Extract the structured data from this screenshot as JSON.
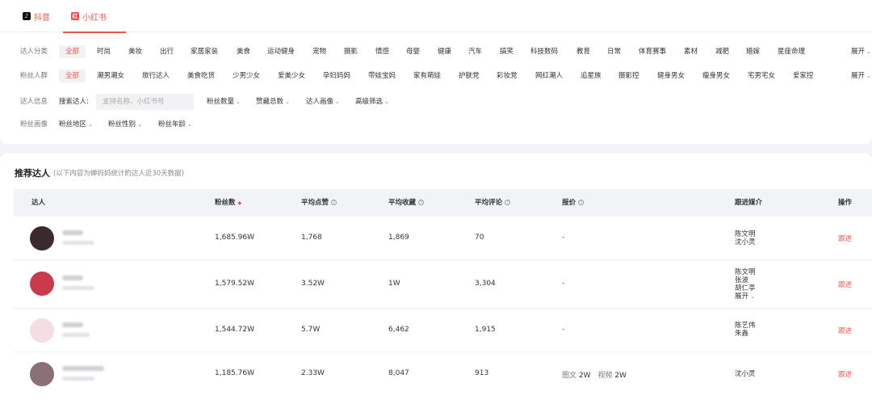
{
  "tabs": [
    {
      "label": "抖音",
      "icon": "douyin-logo-icon"
    },
    {
      "label": "小红书",
      "icon": "xiaohongshu-logo-icon",
      "active": true
    }
  ],
  "filters": {
    "category": {
      "label": "达人分类",
      "items": [
        "全部",
        "时尚",
        "美妆",
        "出行",
        "家居家装",
        "美食",
        "运动健身",
        "宠物",
        "摄影",
        "情感",
        "母婴",
        "健康",
        "汽车",
        "搞笑",
        "科技数码",
        "教育",
        "日常",
        "体育赛事",
        "素材",
        "减肥",
        "婚嫁",
        "星座命理"
      ],
      "expand": "展开"
    },
    "crowd": {
      "label": "粉丝人群",
      "items": [
        "全部",
        "潮男潮女",
        "旅行达人",
        "美食吃货",
        "少男少女",
        "爱美少女",
        "孕妇妈妈",
        "带娃宝妈",
        "家有萌娃",
        "护肤党",
        "彩妆党",
        "网红潮人",
        "追星族",
        "摄影控",
        "健身男女",
        "瘦身男女",
        "宅男宅女",
        "爱家控"
      ],
      "expand": "展开"
    },
    "info": {
      "label": "达人信息",
      "search_label": "搜索达人:",
      "search_placeholder": "支持名称、小红书号",
      "dropdowns": [
        "粉丝数量",
        "赞藏总数",
        "达人画像",
        "高级筛选"
      ]
    },
    "portrait": {
      "label": "粉丝画像",
      "dropdowns": [
        "粉丝地区",
        "粉丝性别",
        "粉丝年龄"
      ]
    }
  },
  "section": {
    "title": "推荐达人",
    "subtitle": "(以下内容为蝉妈妈统计的达人近30天数据)"
  },
  "table": {
    "columns": {
      "creator": "达人",
      "fans": "粉丝数",
      "likes": "平均点赞",
      "collects": "平均收藏",
      "comments": "平均评论",
      "quote": "报价",
      "media": "跟进媒介",
      "action": "操作"
    },
    "rows": [
      {
        "fans": "1,685.96W",
        "likes": "1,768",
        "collects": "1,869",
        "comments": "70",
        "quote": "-",
        "media": [
          "陈文明",
          "沈小灵"
        ],
        "action": "跟进",
        "avatar_color": "#3a2a2e"
      },
      {
        "fans": "1,579.52W",
        "likes": "3.52W",
        "collects": "1W",
        "comments": "3,304",
        "quote": "-",
        "media": [
          "陈文明",
          "张波",
          "胡仁亭"
        ],
        "media_expand": "展开",
        "action": "跟进",
        "avatar_color": "#c93a4a"
      },
      {
        "fans": "1,544.72W",
        "likes": "5.7W",
        "collects": "6,462",
        "comments": "1,915",
        "quote": "-",
        "media": [
          "陈艺伟",
          "朱鑫"
        ],
        "action": "跟进",
        "avatar_color": "#f4dde3"
      },
      {
        "fans": "1,185.76W",
        "likes": "2.33W",
        "collects": "8,047",
        "comments": "913",
        "quote_parts": {
          "a_label": "图文",
          "a_value": "2W",
          "b_label": "视频",
          "b_value": "2W"
        },
        "media": [
          "沈小灵"
        ],
        "action": "跟进",
        "avatar_color": "#8a7075"
      }
    ]
  }
}
